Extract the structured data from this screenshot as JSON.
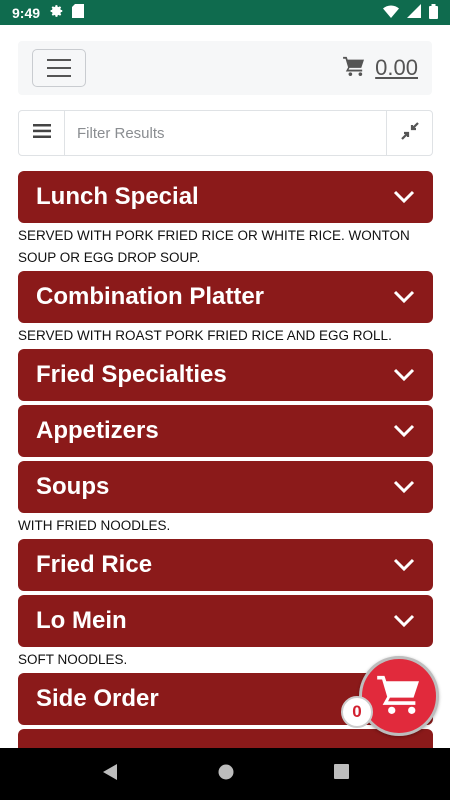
{
  "status_bar": {
    "time": "9:49"
  },
  "navbar": {
    "cart_amount": "0.00"
  },
  "filter": {
    "placeholder": "Filter Results"
  },
  "categories": [
    {
      "label": "Lunch Special",
      "description": "SERVED WITH PORK FRIED RICE OR WHITE RICE. WONTON SOUP OR EGG DROP SOUP."
    },
    {
      "label": "Combination Platter",
      "description": "SERVED WITH ROAST PORK FRIED RICE AND EGG ROLL."
    },
    {
      "label": "Fried Specialties",
      "description": ""
    },
    {
      "label": "Appetizers",
      "description": ""
    },
    {
      "label": "Soups",
      "description": "WITH FRIED NOODLES."
    },
    {
      "label": "Fried Rice",
      "description": ""
    },
    {
      "label": "Lo Mein",
      "description": "SOFT NOODLES."
    },
    {
      "label": "Side Order",
      "description": ""
    }
  ],
  "floating_cart": {
    "count": "0"
  },
  "colors": {
    "status_bar": "#0f6b4e",
    "category_bg": "#8b1a1a",
    "floating_cart": "#e12a3c"
  },
  "icons": [
    "settings-icon",
    "sd-card-icon",
    "wifi-icon",
    "signal-icon",
    "battery-icon",
    "menu-icon",
    "cart-icon",
    "list-icon",
    "collapse-icon",
    "chevron-down-icon",
    "back-icon",
    "home-icon",
    "recents-icon"
  ]
}
